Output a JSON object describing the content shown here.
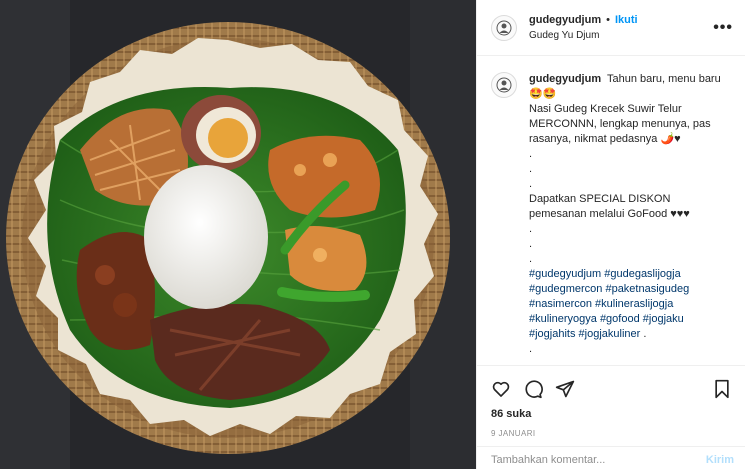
{
  "post": {
    "username": "gudegyudjum",
    "dot": "•",
    "follow_label": "Ikuti",
    "location": "Gudeg Yu Djum",
    "more_label": "•••"
  },
  "caption": {
    "username": "gudegyudjum",
    "lines": [
      "Tahun baru, menu baru",
      "🤩🤩",
      "Nasi Gudeg Krecek Suwir Telur",
      "MERCONNN, lengkap menunya, pas",
      "rasanya, nikmat pedasnya 🌶️♥",
      ".",
      ".",
      ".",
      "Dapatkan SPECIAL DISKON",
      "pemesanan melalui GoFood ♥♥♥",
      ".",
      ".",
      "."
    ],
    "hashtag_lines": [
      [
        "#gudegyudjum",
        "#gudegaslijogja"
      ],
      [
        "#gudegmercon",
        "#paketnasigudeg"
      ],
      [
        "#nasimercon",
        "#kulineraslijogja"
      ],
      [
        "#kulineryogya",
        "#gofood",
        "#jogjaku"
      ],
      [
        "#jogjahits",
        "#jogjakuliner",
        "."
      ]
    ],
    "trailing": "."
  },
  "actions": {
    "like_icon": "heart-icon",
    "comment_icon": "comment-icon",
    "share_icon": "share-icon",
    "save_icon": "bookmark-icon"
  },
  "likes": "86 suka",
  "date": "9 JANUARI",
  "comment": {
    "placeholder": "Tambahkan komentar...",
    "post_label": "Kirim"
  },
  "colors": {
    "link_blue": "#0095f6",
    "hashtag": "#00376b",
    "muted": "#8e8e8e",
    "border": "#efefef"
  }
}
